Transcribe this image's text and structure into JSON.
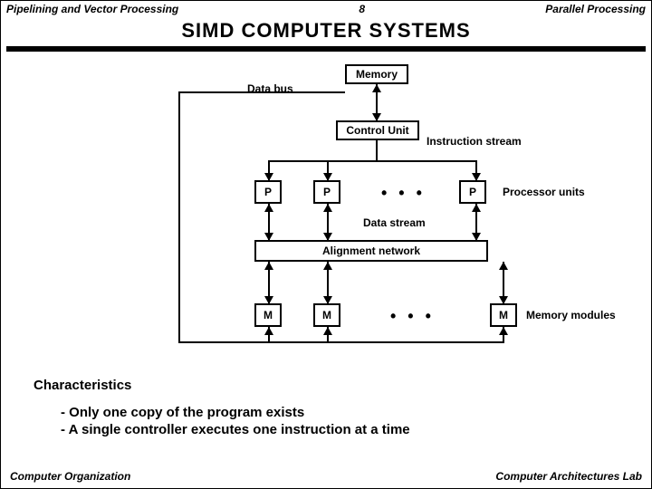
{
  "header": {
    "left": "Pipelining and Vector Processing",
    "center": "8",
    "right": "Parallel Processing"
  },
  "title": "SIMD  COMPUTER  SYSTEMS",
  "diagram": {
    "memory": "Memory",
    "data_bus": "Data bus",
    "control_unit": "Control Unit",
    "instruction_stream": "Instruction stream",
    "processor_units": "Processor units",
    "p": "P",
    "data_stream": "Data stream",
    "alignment_network": "Alignment network",
    "m": "M",
    "memory_modules": "Memory modules",
    "dots": "• • •"
  },
  "characteristics_heading": "Characteristics",
  "bullet1": "- Only one copy of the program exists",
  "bullet2": "- A single controller executes one instruction at a time",
  "footer": {
    "left": "Computer Organization",
    "right": "Computer Architectures Lab"
  }
}
